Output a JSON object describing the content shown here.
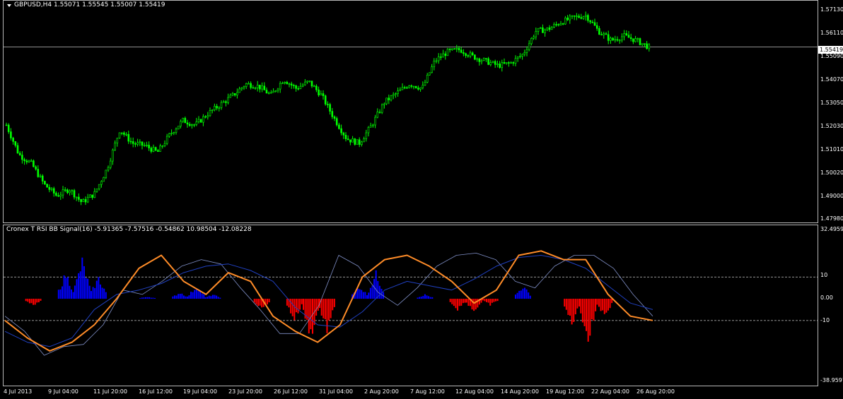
{
  "chart": {
    "symbol_info": "GBPUSD,H4  1.55071 1.55545 1.55007 1.55419",
    "current_price": "1.55419",
    "price_axis": [
      "1.57130",
      "1.56110",
      "1.55090",
      "1.54070",
      "1.53050",
      "1.52030",
      "1.51010",
      "1.50020",
      "1.49000",
      "1.47980"
    ],
    "time_axis": [
      "4 Jul 2013",
      "9 Jul 04:00",
      "11 Jul 20:00",
      "16 Jul 12:00",
      "19 Jul 04:00",
      "23 Jul 20:00",
      "26 Jul 12:00",
      "31 Jul 04:00",
      "2 Aug 20:00",
      "7 Aug 12:00",
      "12 Aug 04:00",
      "14 Aug 20:00",
      "19 Aug 12:00",
      "22 Aug 04:00",
      "26 Aug 20:00"
    ],
    "colors": {
      "candles": "#00ff00",
      "bid_line": "#c0c0c0",
      "grid": "#b8b8b8"
    }
  },
  "indicator": {
    "title": "Cronex T RSI BB Signal(16) -5.91365 -7.57516 -0.54862 10.98504 -12.08228",
    "axis": [
      "32.4959",
      "10",
      "0.00",
      "-10",
      "-38.9597"
    ],
    "levels": [
      10,
      0,
      -10
    ],
    "colors": {
      "up_histogram": "#0000ff",
      "down_histogram": "#ff0000",
      "orange_line": "#ff8c28",
      "blue_line": "#2040c0",
      "thin_line": "#8090c8"
    }
  },
  "chart_data": [
    {
      "type": "candlestick",
      "title": "GBPUSD,H4",
      "ylim": [
        1.4798,
        1.5713
      ],
      "x": [
        "4 Jul 2013",
        "9 Jul 04:00",
        "11 Jul 20:00",
        "16 Jul 12:00",
        "19 Jul 04:00",
        "23 Jul 20:00",
        "26 Jul 12:00",
        "31 Jul 04:00",
        "2 Aug 20:00",
        "7 Aug 12:00",
        "12 Aug 04:00",
        "14 Aug 20:00",
        "19 Aug 12:00",
        "22 Aug 04:00",
        "26 Aug 20:00"
      ],
      "close_path": [
        1.52,
        1.507,
        1.503,
        1.494,
        1.489,
        1.492,
        1.486,
        1.49,
        1.501,
        1.518,
        1.512,
        1.511,
        1.508,
        1.516,
        1.522,
        1.52,
        1.525,
        1.529,
        1.533,
        1.538,
        1.537,
        1.533,
        1.54,
        1.536,
        1.539,
        1.533,
        1.523,
        1.514,
        1.512,
        1.52,
        1.53,
        1.534,
        1.538,
        1.536,
        1.548,
        1.552,
        1.553,
        1.55,
        1.548,
        1.546,
        1.547,
        1.551,
        1.561,
        1.562,
        1.565,
        1.567,
        1.568,
        1.561,
        1.557,
        1.559,
        1.557,
        1.554
      ]
    },
    {
      "type": "line",
      "title": "Cronex T RSI BB Signal(16)",
      "ylim": [
        -38.9597,
        32.4959
      ],
      "series": [
        {
          "values": [
            -8,
            -15,
            -26,
            -22,
            -21,
            -12,
            4,
            2,
            8,
            15,
            18,
            16,
            5,
            -5,
            -16,
            -16,
            -3,
            20,
            15,
            3,
            -3,
            5,
            15,
            20,
            21,
            18,
            8,
            5,
            15,
            20,
            20,
            14,
            2,
            -8
          ]
        },
        {
          "values": [
            -15,
            -20,
            -22,
            -18,
            -5,
            2,
            4,
            7,
            12,
            15,
            16,
            13,
            8,
            -4,
            -12,
            -13,
            -6,
            4,
            8,
            6,
            4,
            9,
            15,
            19,
            20,
            18,
            14,
            6,
            -2,
            -5
          ]
        },
        {
          "values": [
            -10,
            -18,
            -24,
            -20,
            -12,
            0,
            14,
            20,
            8,
            2,
            12,
            8,
            -8,
            -15,
            -20,
            -12,
            10,
            18,
            20,
            15,
            8,
            -2,
            4,
            20,
            22,
            18,
            18,
            2,
            -8,
            -10
          ]
        }
      ],
      "histogram": [
        0,
        -3,
        0,
        12,
        18,
        10,
        0,
        0,
        1,
        0,
        3,
        6,
        2,
        0,
        0,
        -5,
        0,
        -10,
        -18,
        -15,
        0,
        6,
        12,
        0,
        0,
        2,
        0,
        -5,
        -6,
        -3,
        0,
        6,
        0,
        0,
        -12,
        -20,
        -8,
        0,
        0,
        0
      ]
    }
  ]
}
